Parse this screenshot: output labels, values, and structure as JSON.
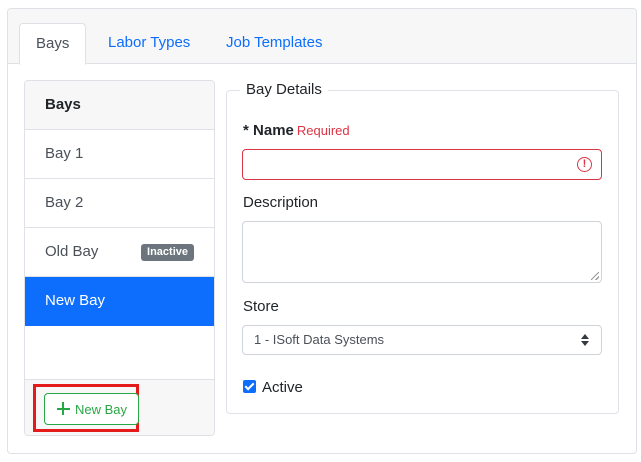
{
  "tabs": [
    {
      "label": "Bays",
      "active": true
    },
    {
      "label": "Labor Types",
      "active": false
    },
    {
      "label": "Job Templates",
      "active": false
    }
  ],
  "bays_list": {
    "header": "Bays",
    "items": [
      {
        "label": "Bay 1",
        "badge": null,
        "selected": false
      },
      {
        "label": "Bay 2",
        "badge": null,
        "selected": false
      },
      {
        "label": "Old Bay",
        "badge": "Inactive",
        "selected": false
      },
      {
        "label": "New Bay",
        "badge": null,
        "selected": true
      }
    ],
    "new_button_label": "New Bay"
  },
  "details": {
    "legend": "Bay Details",
    "name": {
      "required_mark": "* ",
      "label": "Name",
      "required_text": "Required",
      "value": ""
    },
    "description": {
      "label": "Description",
      "value": ""
    },
    "store": {
      "label": "Store",
      "selected": "1 - ISoft Data Systems"
    },
    "active": {
      "label": "Active",
      "checked": true
    }
  },
  "colors": {
    "primary": "#0d6efd",
    "success": "#28a745",
    "danger": "#dc3545",
    "highlight": "#e51b1b",
    "badge": "#6c757d"
  }
}
